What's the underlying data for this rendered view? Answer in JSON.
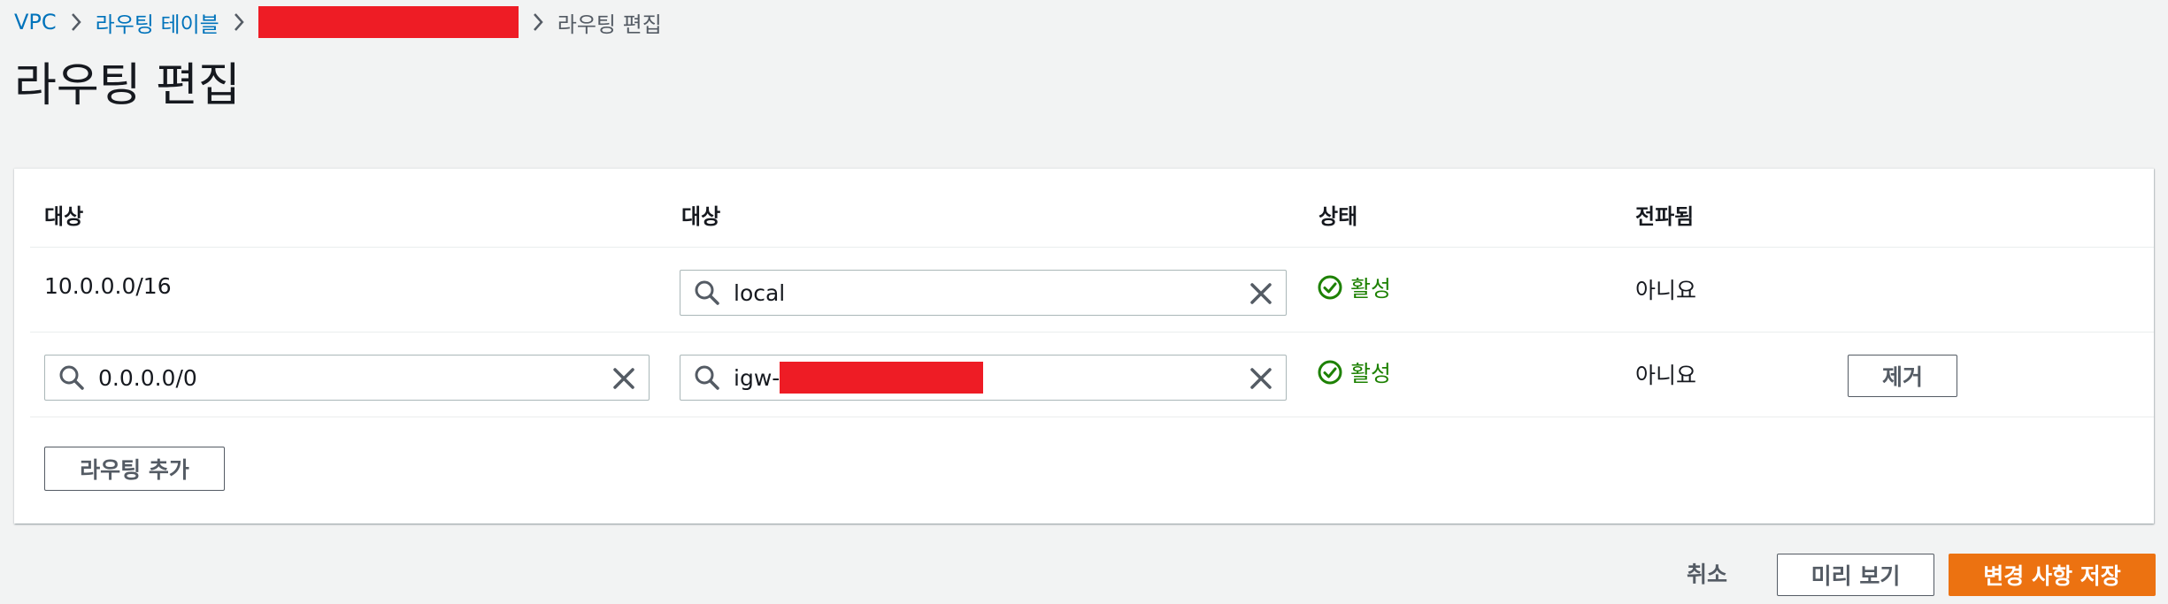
{
  "breadcrumb": {
    "vpc": "VPC",
    "route_tables": "라우팅 테이블",
    "current": "라우팅 편집"
  },
  "page_title": "라우팅 편집",
  "table": {
    "headers": [
      "대상",
      "대상",
      "상태",
      "전파됨"
    ],
    "rows": [
      {
        "destination": "10.0.0.0/16",
        "target": "local",
        "status": "활성",
        "propagated": "아니요"
      },
      {
        "destination": "0.0.0.0/0",
        "target": "igw-",
        "status": "활성",
        "propagated": "아니요",
        "remove_label": "제거"
      }
    ],
    "add_route_label": "라우팅 추가"
  },
  "footer": {
    "cancel": "취소",
    "preview": "미리 보기",
    "save": "변경 사항 저장"
  },
  "colors": {
    "link": "#0073bb",
    "status_ok": "#1d8102",
    "primary": "#ec7211",
    "redaction": "#ee1c25"
  }
}
